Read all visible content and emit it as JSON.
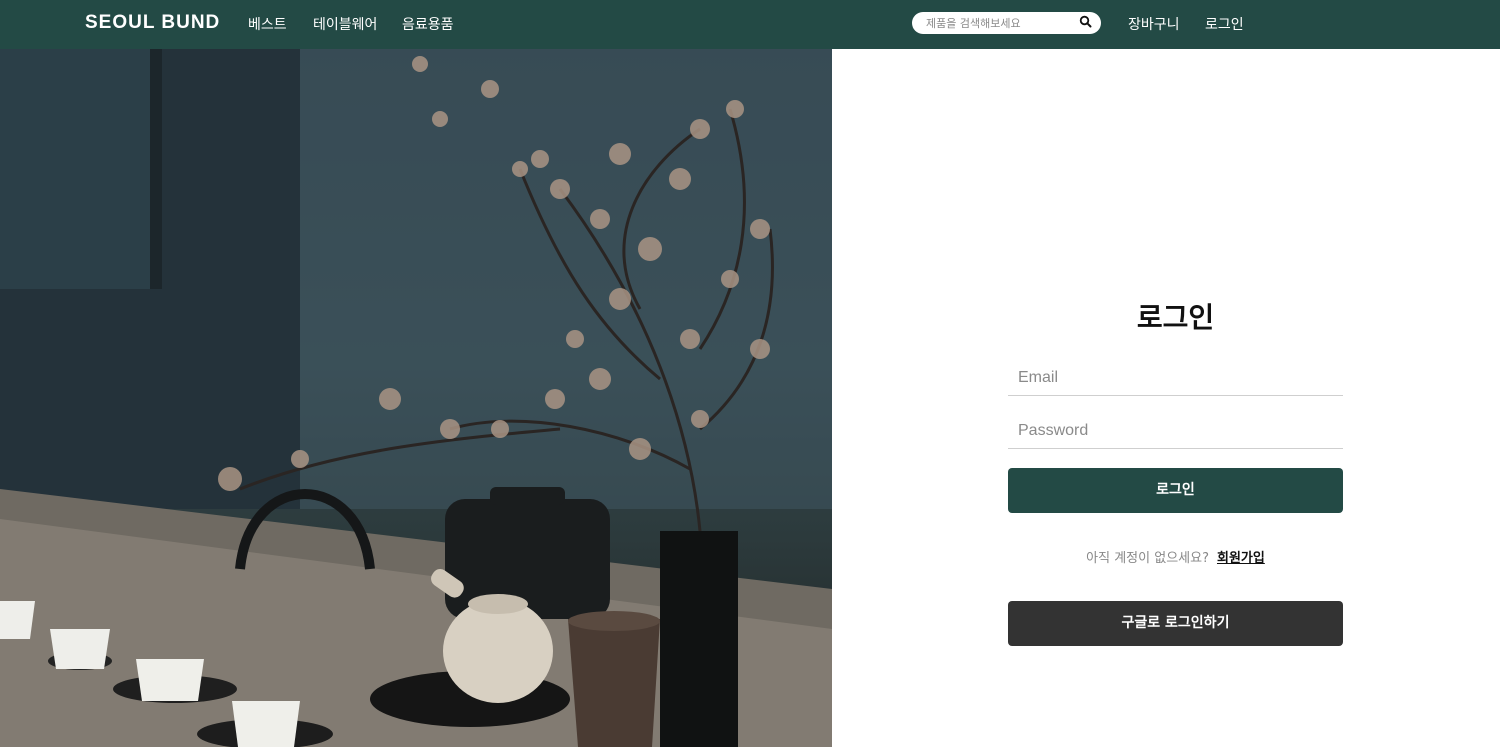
{
  "header": {
    "logo": "SEOUL BUND",
    "nav": [
      {
        "label": "베스트"
      },
      {
        "label": "테이블웨어"
      },
      {
        "label": "음료용품"
      }
    ],
    "search": {
      "placeholder": "제품을 검색해보세요",
      "icon": "search-icon"
    },
    "cart_label": "장바구니",
    "login_label": "로그인"
  },
  "login": {
    "title": "로그인",
    "email_placeholder": "Email",
    "password_placeholder": "Password",
    "submit_label": "로그인",
    "signup_question": "아직 계정이 없으세요?",
    "signup_link": "회원가입",
    "google_label": "구글로 로그인하기"
  },
  "colors": {
    "brand": "#234a45",
    "google_button": "#333333"
  }
}
